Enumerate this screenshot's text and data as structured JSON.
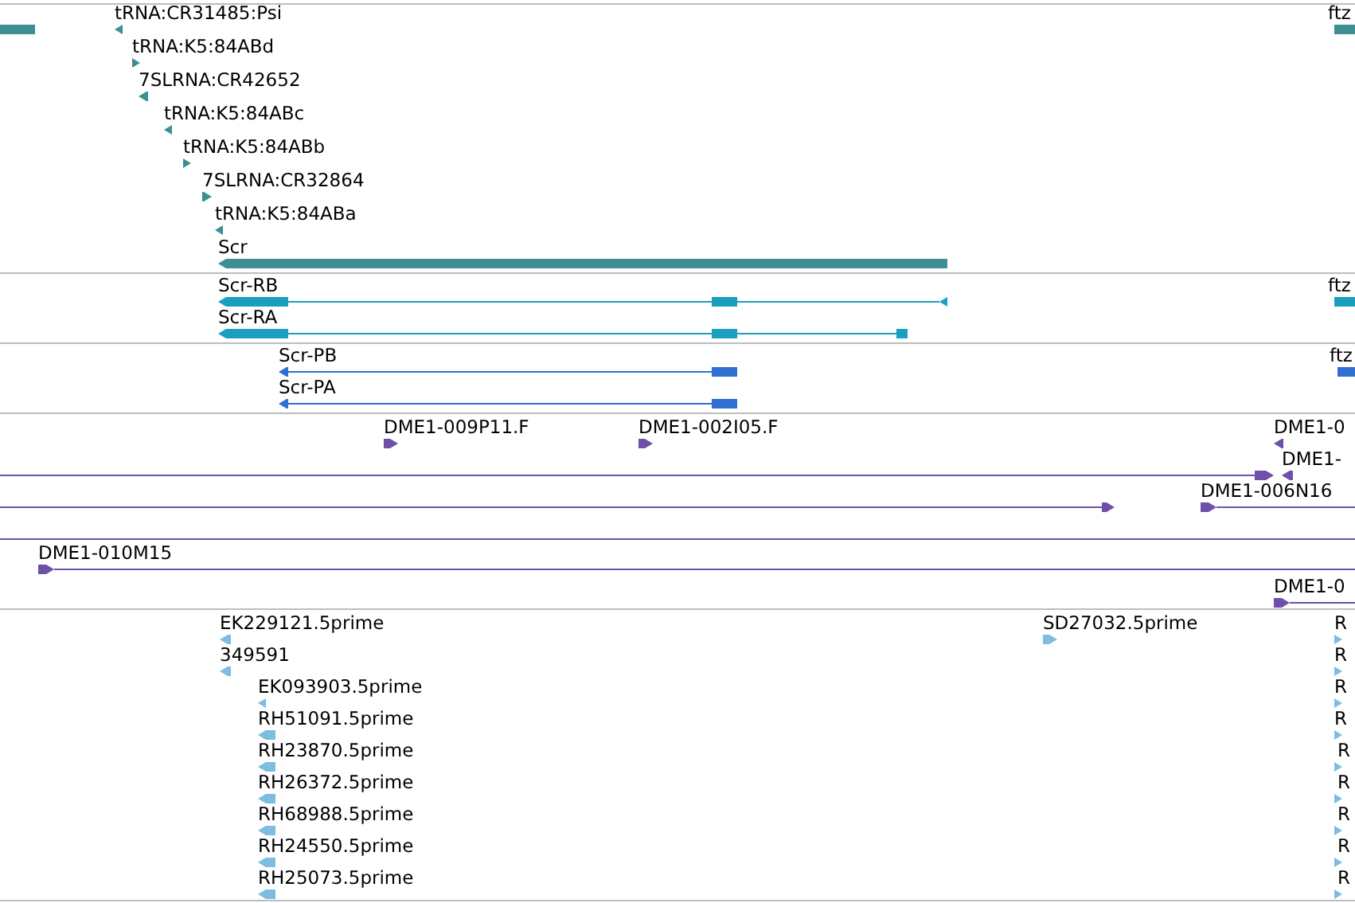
{
  "tracks": [
    {
      "color": "#3d8f94",
      "features": [
        {
          "label": "tRNA:CR31485:Psi",
          "reverse": true
        },
        {
          "label": "tRNA:K5:84ABd",
          "reverse": false
        },
        {
          "label": "7SLRNA:CR42652",
          "reverse": true
        },
        {
          "label": "tRNA:K5:84ABc",
          "reverse": true
        },
        {
          "label": "tRNA:K5:84ABb",
          "reverse": false
        },
        {
          "label": "7SLRNA:CR32864",
          "reverse": false
        },
        {
          "label": "tRNA:K5:84ABa",
          "reverse": true
        },
        {
          "label": "Scr",
          "reverse": true
        },
        {
          "label": "ftz"
        }
      ]
    },
    {
      "color": "#1a9fbf",
      "features": [
        {
          "label": "Scr-RB",
          "reverse": true
        },
        {
          "label": "Scr-RA",
          "reverse": true
        },
        {
          "label": "ftz"
        }
      ]
    },
    {
      "color": "#2e6fd1",
      "features": [
        {
          "label": "Scr-PB",
          "reverse": true
        },
        {
          "label": "Scr-PA",
          "reverse": true
        },
        {
          "label": "ftz"
        }
      ]
    },
    {
      "color": "#6e50a8",
      "features": [
        {
          "label": "DME1-009P11.F",
          "reverse": false
        },
        {
          "label": "DME1-002I05.F",
          "reverse": false
        },
        {
          "label": "DME1-0",
          "reverse": true
        },
        {
          "reverse": false
        },
        {
          "label": "DME1-",
          "reverse": true
        },
        {
          "reverse": false
        },
        {
          "label": "DME1-006N16",
          "reverse": false
        },
        {
          "label": "DME1-010M15",
          "reverse": false
        },
        {
          "label": "DME1-0",
          "reverse": false
        }
      ]
    },
    {
      "color": "#7fbde0",
      "features": [
        {
          "label": "EK229121.5prime",
          "reverse": true
        },
        {
          "label": "349591",
          "reverse": true
        },
        {
          "label": "EK093903.5prime",
          "reverse": true
        },
        {
          "label": "RH51091.5prime",
          "reverse": true
        },
        {
          "label": "RH23870.5prime",
          "reverse": true
        },
        {
          "label": "RH26372.5prime",
          "reverse": true
        },
        {
          "label": "RH68988.5prime",
          "reverse": true
        },
        {
          "label": "RH24550.5prime",
          "reverse": true
        },
        {
          "label": "RH25073.5prime",
          "reverse": true
        },
        {
          "label": "SD27032.5prime",
          "reverse": false
        },
        {
          "label": "R",
          "reverse": false
        },
        {
          "label": "R",
          "reverse": false
        },
        {
          "label": "R",
          "reverse": false
        },
        {
          "label": "R",
          "reverse": false
        },
        {
          "label": "R",
          "reverse": false
        },
        {
          "label": "R",
          "reverse": false
        },
        {
          "label": "R",
          "reverse": false
        },
        {
          "label": "R",
          "reverse": false
        },
        {
          "label": "R",
          "reverse": false
        }
      ]
    }
  ]
}
